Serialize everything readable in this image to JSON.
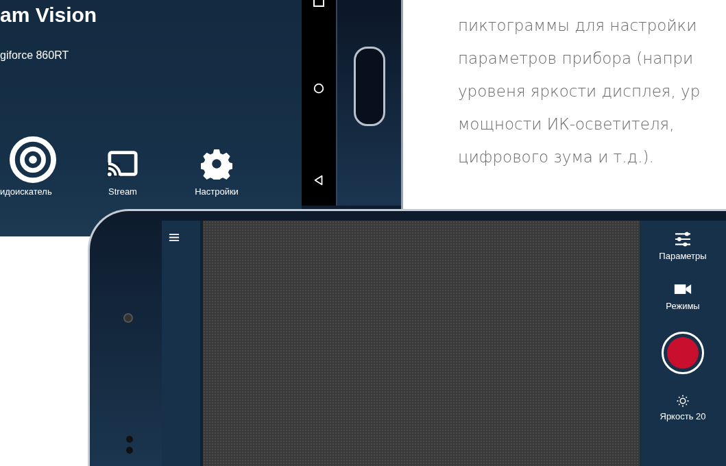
{
  "top_phone": {
    "app_title": "am Vision",
    "device_name": "giforce 860RT",
    "menu": [
      {
        "kind": "target",
        "label": "идоискатель"
      },
      {
        "kind": "cast",
        "label": "Stream"
      },
      {
        "kind": "gear",
        "label": "Настройки"
      }
    ]
  },
  "description": {
    "lines": [
      "пиктограммы для настройки",
      "параметров прибора (напри",
      "уровеня яркости дисплея, ур",
      "мощности ИК-осветителя,",
      "цифрового зума и т.д.)."
    ]
  },
  "bottom_phone": {
    "controls": [
      {
        "kind": "sliders",
        "label": "Параметры"
      },
      {
        "kind": "camera",
        "label": "Режимы"
      },
      {
        "kind": "record"
      },
      {
        "kind": "sun",
        "label": "Яркость 20"
      }
    ]
  }
}
